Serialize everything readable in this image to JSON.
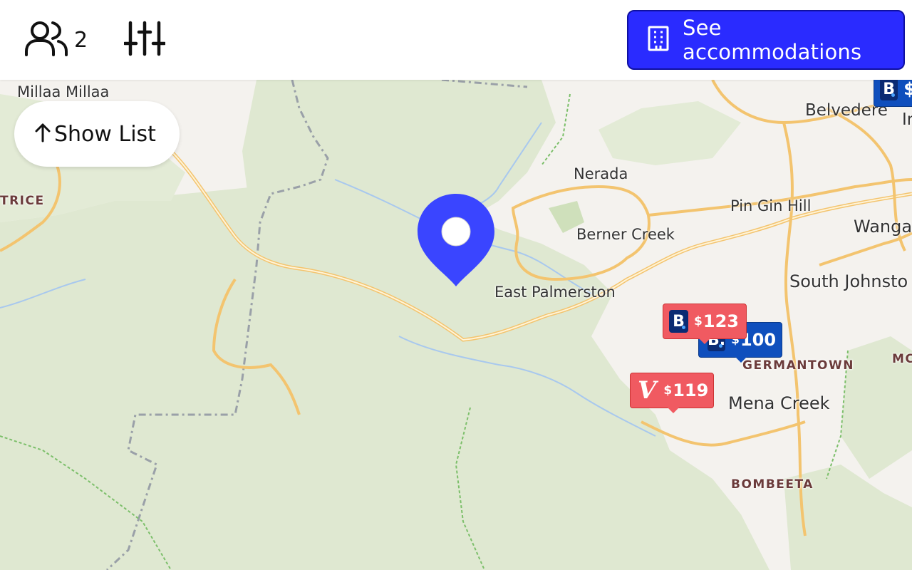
{
  "header": {
    "guests_icon": "users-icon",
    "guests_count": "2",
    "filters_icon": "sliders-icon",
    "accommodations_icon": "building-icon",
    "accommodations_label": "See accommodations",
    "accent_color": "#2a2bff"
  },
  "map": {
    "show_list": {
      "icon": "arrow-up-icon",
      "label": "Show List"
    },
    "places": [
      "Millaa Millaa",
      "TRICE",
      "Nerada",
      "Pin Gin Hill",
      "Berner Creek",
      "Belvedere",
      "Wanga",
      "South Johnsto",
      "East Palmerston",
      "GERMANTOWN",
      "Mena Creek",
      "BOMBEETA",
      "MC",
      "In"
    ],
    "selected_location_icon": "map-pin-icon",
    "price_markers": [
      {
        "provider": "booking",
        "currency": "$",
        "amount": "123",
        "color": "#f05a61"
      },
      {
        "provider": "booking",
        "currency": "$",
        "amount": "100",
        "color": "#0f4fbd"
      },
      {
        "provider": "vrbo",
        "currency": "$",
        "amount": "119",
        "color": "#f05a61"
      },
      {
        "provider": "booking",
        "currency": "$",
        "amount": "",
        "color": "#0f4fbd"
      }
    ]
  }
}
